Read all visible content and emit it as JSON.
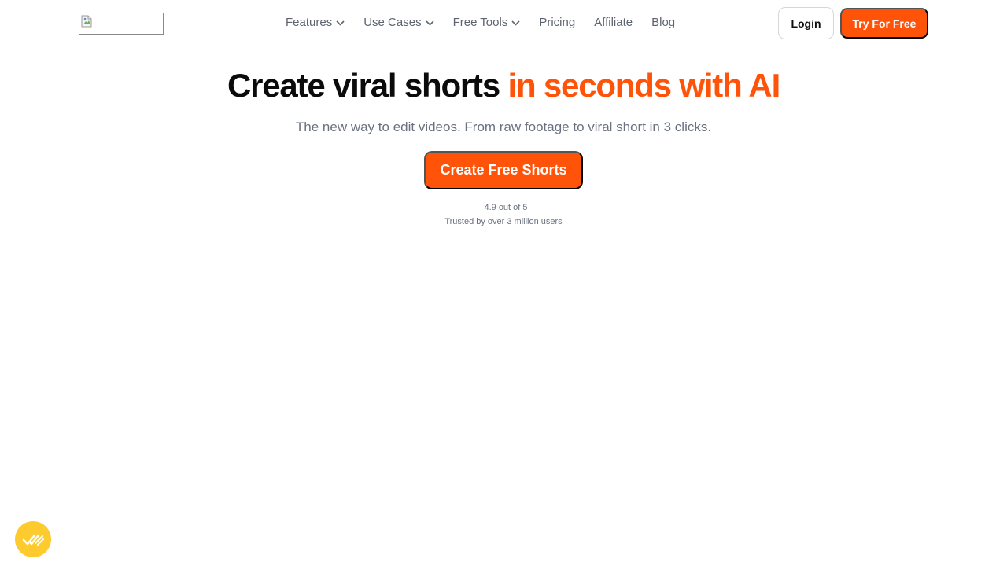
{
  "header": {
    "logo_alt": "",
    "nav": [
      {
        "label": "Features",
        "has_dropdown": true
      },
      {
        "label": "Use Cases",
        "has_dropdown": true
      },
      {
        "label": "Free Tools",
        "has_dropdown": true
      },
      {
        "label": "Pricing",
        "has_dropdown": false
      },
      {
        "label": "Affiliate",
        "has_dropdown": false
      },
      {
        "label": "Blog",
        "has_dropdown": false
      }
    ],
    "login_label": "Login",
    "try_label": "Try For Free"
  },
  "hero": {
    "title_dark": "Create viral shorts",
    "title_accent": "in seconds with AI",
    "subtitle": "The new way to edit videos. From raw footage to viral short in 3 clicks.",
    "cta_label": "Create Free Shorts",
    "rating_text": "4.9 out of 5",
    "trust_text": "Trusted by over 3 million users"
  },
  "colors": {
    "accent": "#ff5309",
    "badge": "#fecb2f",
    "text_muted": "#6a7280"
  },
  "icons": {
    "nav_dropdown": "chevron-down-icon",
    "floating_badge": "checkmarks-icon",
    "logo": "broken-image-icon"
  }
}
